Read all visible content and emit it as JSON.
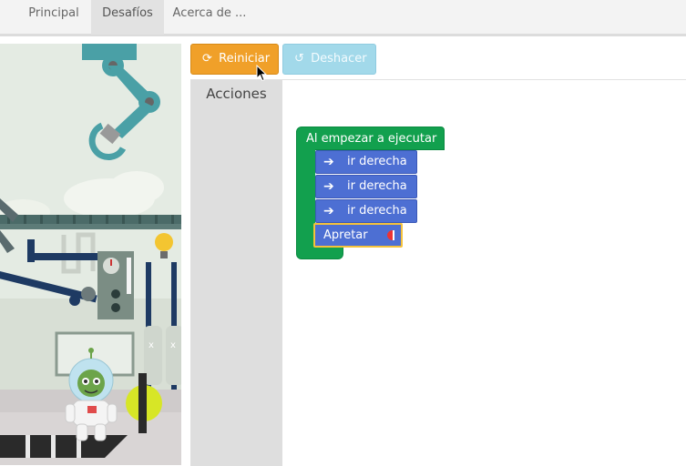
{
  "nav": {
    "tabs": [
      "Principal",
      "Desafíos",
      "Acerca de ..."
    ],
    "active_tab": "Desafíos"
  },
  "toolbar": {
    "reset_label": "Reiniciar",
    "undo_label": "Deshacer"
  },
  "toolbox": {
    "category_label": "Acciones"
  },
  "program": {
    "start_block_label": "Al empezar a ejecutar",
    "statements": [
      "ir derecha",
      "ir derecha",
      "ir derecha"
    ],
    "press_block_label": "Apretar"
  },
  "colors": {
    "tab_bar": "#f3f3f3",
    "reset_button": "#f0a029",
    "undo_button": "#a2d9ea",
    "start_block": "#12a04e",
    "action_block": "#4d6fd3",
    "selected_outline": "#f5c23b",
    "toolbox": "#dedede"
  },
  "icons": {
    "reset": "refresh-icon",
    "undo": "undo-icon",
    "move": "arrow-right-icon",
    "press": "red-button-icon"
  }
}
